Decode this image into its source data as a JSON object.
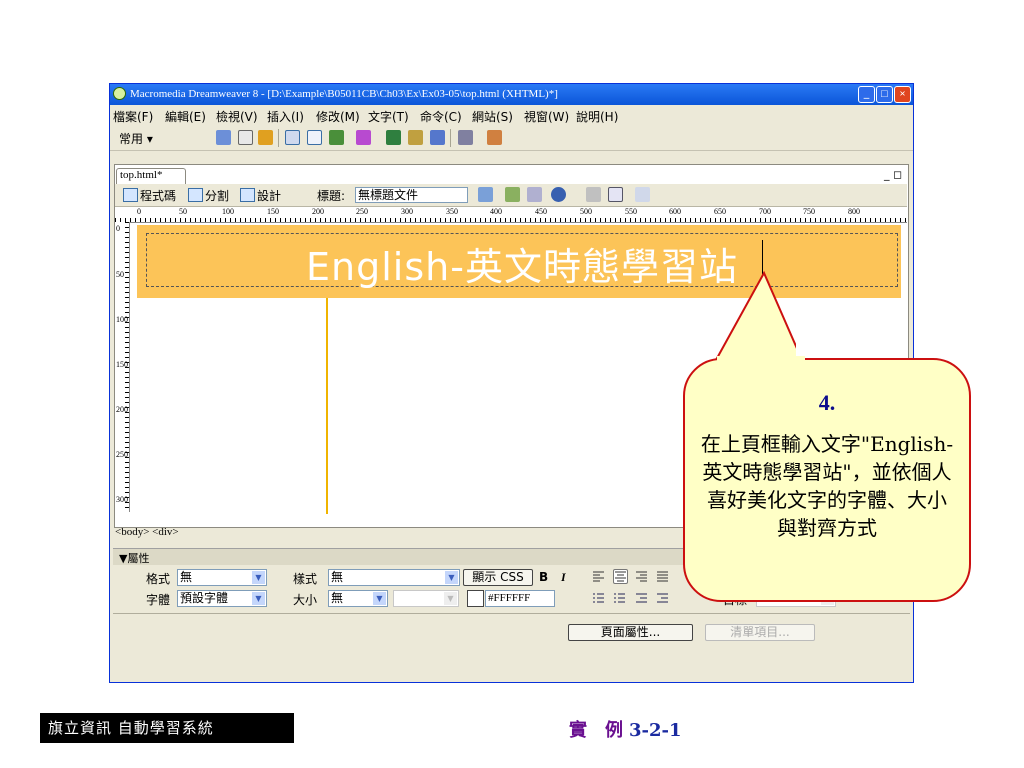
{
  "window": {
    "title": "Macromedia Dreamweaver 8 - [D:\\Example\\B05011CB\\Ch03\\Ex\\Ex03-05\\top.html (XHTML)*]",
    "controls": [
      "minimize",
      "maximize",
      "close"
    ]
  },
  "menubar": [
    "檔案(F)",
    "編輯(E)",
    "檢視(V)",
    "插入(I)",
    "修改(M)",
    "文字(T)",
    "命令(C)",
    "網站(S)",
    "視窗(W)",
    "說明(H)"
  ],
  "insertbar": {
    "category": "常用 ▾"
  },
  "document": {
    "tab": "top.html*",
    "tab_controls": "_ ◻ ×",
    "views": {
      "code": "程式碼",
      "split": "分割",
      "design": "設計"
    },
    "title_label": "標題:",
    "title_value": "無標題文件",
    "ruler_labels": [
      "0",
      "50",
      "100",
      "150",
      "200",
      "250",
      "300",
      "350",
      "400",
      "450",
      "500",
      "550",
      "600",
      "650",
      "700",
      "750",
      "800"
    ],
    "vruler_labels": [
      "0",
      "50",
      "100",
      "150",
      "200",
      "250",
      "300"
    ],
    "banner_text": "English-英文時態學習站",
    "tag_selector": "<body> <div>"
  },
  "properties": {
    "header": "▼屬性",
    "format_label": "格式",
    "format_value": "無",
    "style_label": "樣式",
    "style_value": "無",
    "css_button": "顯示 CSS",
    "bold": "B",
    "italic": "I",
    "font_label": "字體",
    "font_value": "預設字體",
    "size_label": "大小",
    "size_value": "無",
    "color_value": "#FFFFFF",
    "target_label": "目標",
    "page_props_button": "頁面屬性...",
    "list_item_button": "清單項目..."
  },
  "callout": {
    "step": "4.",
    "text": "在上頁框輸入文字\"English-英文時態學習站\"，並依個人喜好美化文字的字體、大小與對齊方式"
  },
  "footer": {
    "left": "旗立資訊 自動學習系統",
    "right_label": "實　例",
    "right_num": "3-2-1"
  }
}
